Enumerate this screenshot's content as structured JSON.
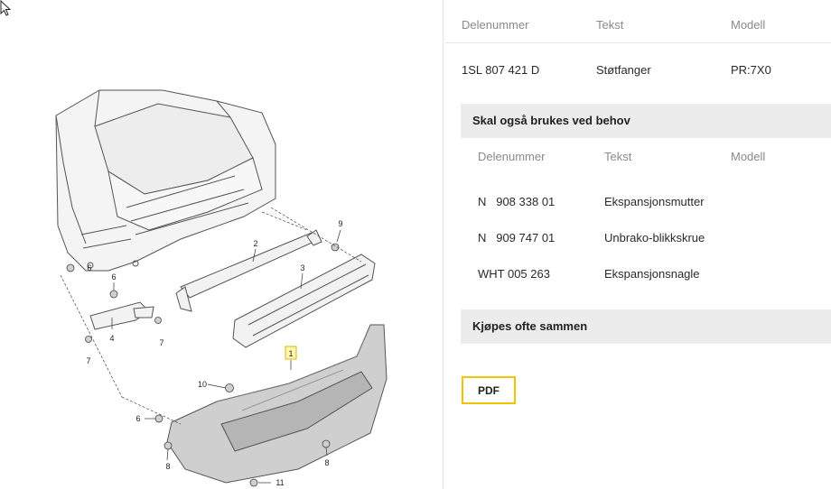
{
  "table_header": {
    "col_part": "Delenummer",
    "col_text": "Tekst",
    "col_model": "Modell"
  },
  "main_part": {
    "number": "1SL 807 421 D",
    "text": "Støtfanger",
    "model": "PR:7X0"
  },
  "also_needed": {
    "title": "Skal også brukes ved behov",
    "header": {
      "col_part": "Delenummer",
      "col_text": "Tekst",
      "col_model": "Modell"
    },
    "items": [
      {
        "number": "N   908 338 01",
        "text": "Ekspansjonsmutter"
      },
      {
        "number": "N   909 747 01",
        "text": "Unbrako-blikkskrue"
      },
      {
        "number": "WHT 005 263",
        "text": "Ekspansjonsnagle"
      }
    ]
  },
  "often_bought": {
    "title": "Kjøpes ofte sammen"
  },
  "pdf_button": {
    "label": "PDF"
  },
  "accent_color": "#f1c400",
  "diagram": {
    "callouts": [
      "1",
      "2",
      "3",
      "4",
      "6",
      "6",
      "7",
      "7",
      "8",
      "8",
      "9",
      "10",
      "11"
    ],
    "highlighted_callout": "1"
  }
}
